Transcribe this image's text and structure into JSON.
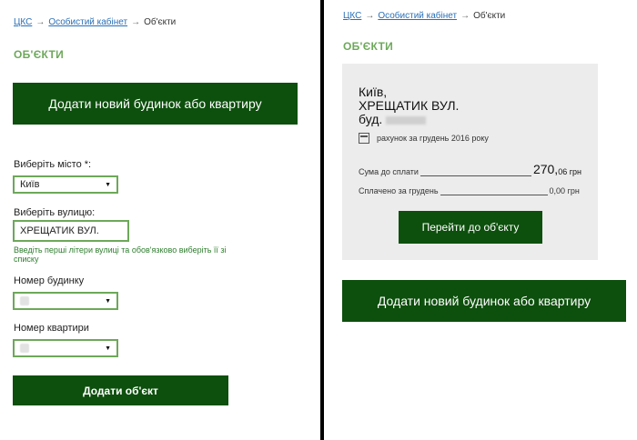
{
  "breadcrumb": {
    "home": "ЦКС",
    "cabinet": "Особистий кабінет",
    "current": "Об'єкти",
    "arrow": "→"
  },
  "left": {
    "title": "ОБ'ЄКТИ",
    "add_new_button": "Додати новий будинок або квартиру",
    "city_label": "Виберіть місто *:",
    "city_value": "Київ",
    "street_label": "Виберіть вулицю:",
    "street_value": "ХРЕЩАТИК ВУЛ.",
    "street_hint": "Введіть перші літери вулиці та обов'язково виберіть її зі списку",
    "house_label": "Номер будинку",
    "apartment_label": "Номер квартири",
    "add_object_button": "Додати об'єкт"
  },
  "right": {
    "title": "ОБ'ЄКТИ",
    "card": {
      "city": "Київ,",
      "street": "ХРЕЩАТИК ВУЛ.",
      "building_prefix": "буд.",
      "bill_text": "рахунок за грудень 2016 року",
      "due_label": "Сума до сплати",
      "due_amount_main": "270,",
      "due_amount_cents": "06 грн",
      "paid_label": "Сплачено за грудень",
      "paid_amount": "0,00 грн",
      "goto_button": "Перейти до об'єкту"
    },
    "add_new_button": "Додати новий будинок або квартиру"
  },
  "icons": {
    "calendar": "calendar-icon",
    "caret": "chevron-down-icon"
  },
  "colors": {
    "primary_green": "#0d4f0d",
    "accent_green": "#6da85a",
    "link_blue": "#2a6fb7",
    "card_bg": "#ececec"
  }
}
